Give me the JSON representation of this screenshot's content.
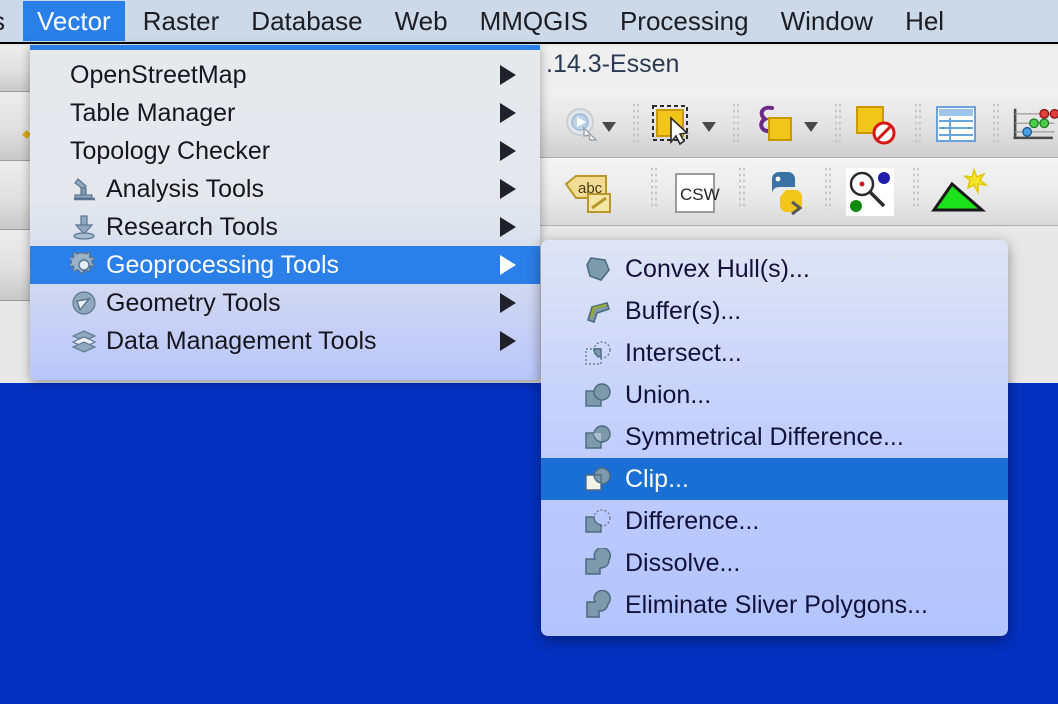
{
  "app": {
    "title_fragment": ".14.3-Essen",
    "desktop_color": "#0531c2",
    "accent_color": "#2a7fe8",
    "submenu_highlight_color": "#1a6fd4"
  },
  "menubar": {
    "items": [
      {
        "label": "s",
        "active": false,
        "clipped": true
      },
      {
        "label": "Vector",
        "active": true,
        "clipped": false
      },
      {
        "label": "Raster",
        "active": false,
        "clipped": false
      },
      {
        "label": "Database",
        "active": false,
        "clipped": false
      },
      {
        "label": "Web",
        "active": false,
        "clipped": false
      },
      {
        "label": "MMQGIS",
        "active": false,
        "clipped": false
      },
      {
        "label": "Processing",
        "active": false,
        "clipped": false
      },
      {
        "label": "Window",
        "active": false,
        "clipped": false
      },
      {
        "label": "Hel",
        "active": false,
        "clipped": true
      }
    ]
  },
  "vector_menu": {
    "items": [
      {
        "label": "OpenStreetMap",
        "icon": "none",
        "submenu": true,
        "selected": false
      },
      {
        "label": "Table Manager",
        "icon": "none",
        "submenu": true,
        "selected": false
      },
      {
        "label": "Topology Checker",
        "icon": "none",
        "submenu": true,
        "selected": false
      },
      {
        "label": "Analysis Tools",
        "icon": "microscope-icon",
        "submenu": true,
        "selected": false
      },
      {
        "label": "Research Tools",
        "icon": "download-arrow-icon",
        "submenu": true,
        "selected": false
      },
      {
        "label": "Geoprocessing Tools",
        "icon": "gear-icon",
        "submenu": true,
        "selected": true
      },
      {
        "label": "Geometry Tools",
        "icon": "geometry-icon",
        "submenu": true,
        "selected": false
      },
      {
        "label": "Data Management Tools",
        "icon": "layers-icon",
        "submenu": true,
        "selected": false
      }
    ]
  },
  "geoprocessing_submenu": {
    "items": [
      {
        "label": "Convex Hull(s)...",
        "icon": "convex-hull-icon",
        "selected": false
      },
      {
        "label": "Buffer(s)...",
        "icon": "buffer-icon",
        "selected": false
      },
      {
        "label": "Intersect...",
        "icon": "intersect-icon",
        "selected": false
      },
      {
        "label": "Union...",
        "icon": "union-icon",
        "selected": false
      },
      {
        "label": "Symmetrical Difference...",
        "icon": "sym-difference-icon",
        "selected": false
      },
      {
        "label": "Clip...",
        "icon": "clip-icon",
        "selected": true
      },
      {
        "label": "Difference...",
        "icon": "difference-icon",
        "selected": false
      },
      {
        "label": "Dissolve...",
        "icon": "dissolve-icon",
        "selected": false
      },
      {
        "label": "Eliminate Sliver Polygons...",
        "icon": "eliminate-icon",
        "selected": false
      }
    ]
  },
  "toolbar_row_1": {
    "icons": [
      "run-feature-action-icon",
      "select-features-by-area-icon",
      "select-features-by-expression-icon",
      "deselect-features-icon",
      "open-attribute-table-icon",
      "measure-icon"
    ]
  },
  "toolbar_row_2": {
    "icons": [
      "label-edit-icon",
      "csw-catalog-icon",
      "python-console-icon",
      "search-layers-icon",
      "terrain-profile-icon"
    ]
  }
}
